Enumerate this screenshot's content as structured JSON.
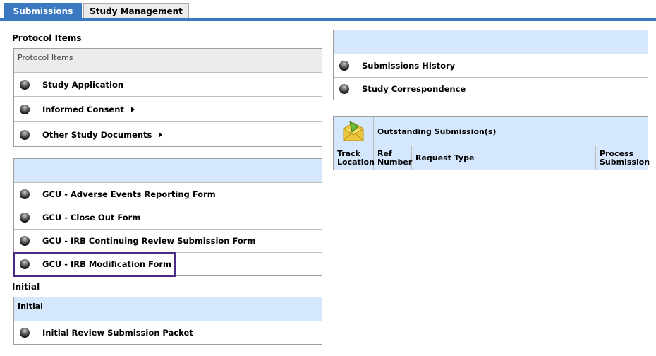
{
  "tabs": [
    {
      "label": "Submissions",
      "active": true
    },
    {
      "label": "Study Management",
      "active": false
    }
  ],
  "protocol": {
    "section_label": "Protocol Items",
    "panel_header": "Protocol Items",
    "items": [
      {
        "label": "Study Application",
        "has_arrow": false
      },
      {
        "label": "Informed Consent",
        "has_arrow": true
      },
      {
        "label": "Other Study Documents",
        "has_arrow": true
      }
    ]
  },
  "gcu_forms": {
    "panel_header": "",
    "items": [
      {
        "label": "GCU - Adverse Events Reporting Form"
      },
      {
        "label": "GCU - Close Out Form"
      },
      {
        "label": "GCU - IRB Continuing Review Submission Form"
      },
      {
        "label": "GCU - IRB Modification Form"
      }
    ]
  },
  "initial": {
    "section_label": "Initial",
    "panel_header": "Initial",
    "items": [
      {
        "label": "Initial Review Submission Packet"
      }
    ]
  },
  "history": {
    "panel_header": "",
    "items": [
      {
        "label": "Submissions History"
      },
      {
        "label": "Study Correspondence"
      }
    ]
  },
  "outstanding": {
    "title": "Outstanding Submission(s)",
    "icon": "envelope-folder-icon",
    "columns": [
      "Track Location",
      "Ref Number",
      "Request Type",
      "Process Submission"
    ]
  },
  "colors": {
    "tab_active": "#3a78c2",
    "panel_header_blue": "#d5e7fc",
    "highlight": "#4b2a86"
  }
}
